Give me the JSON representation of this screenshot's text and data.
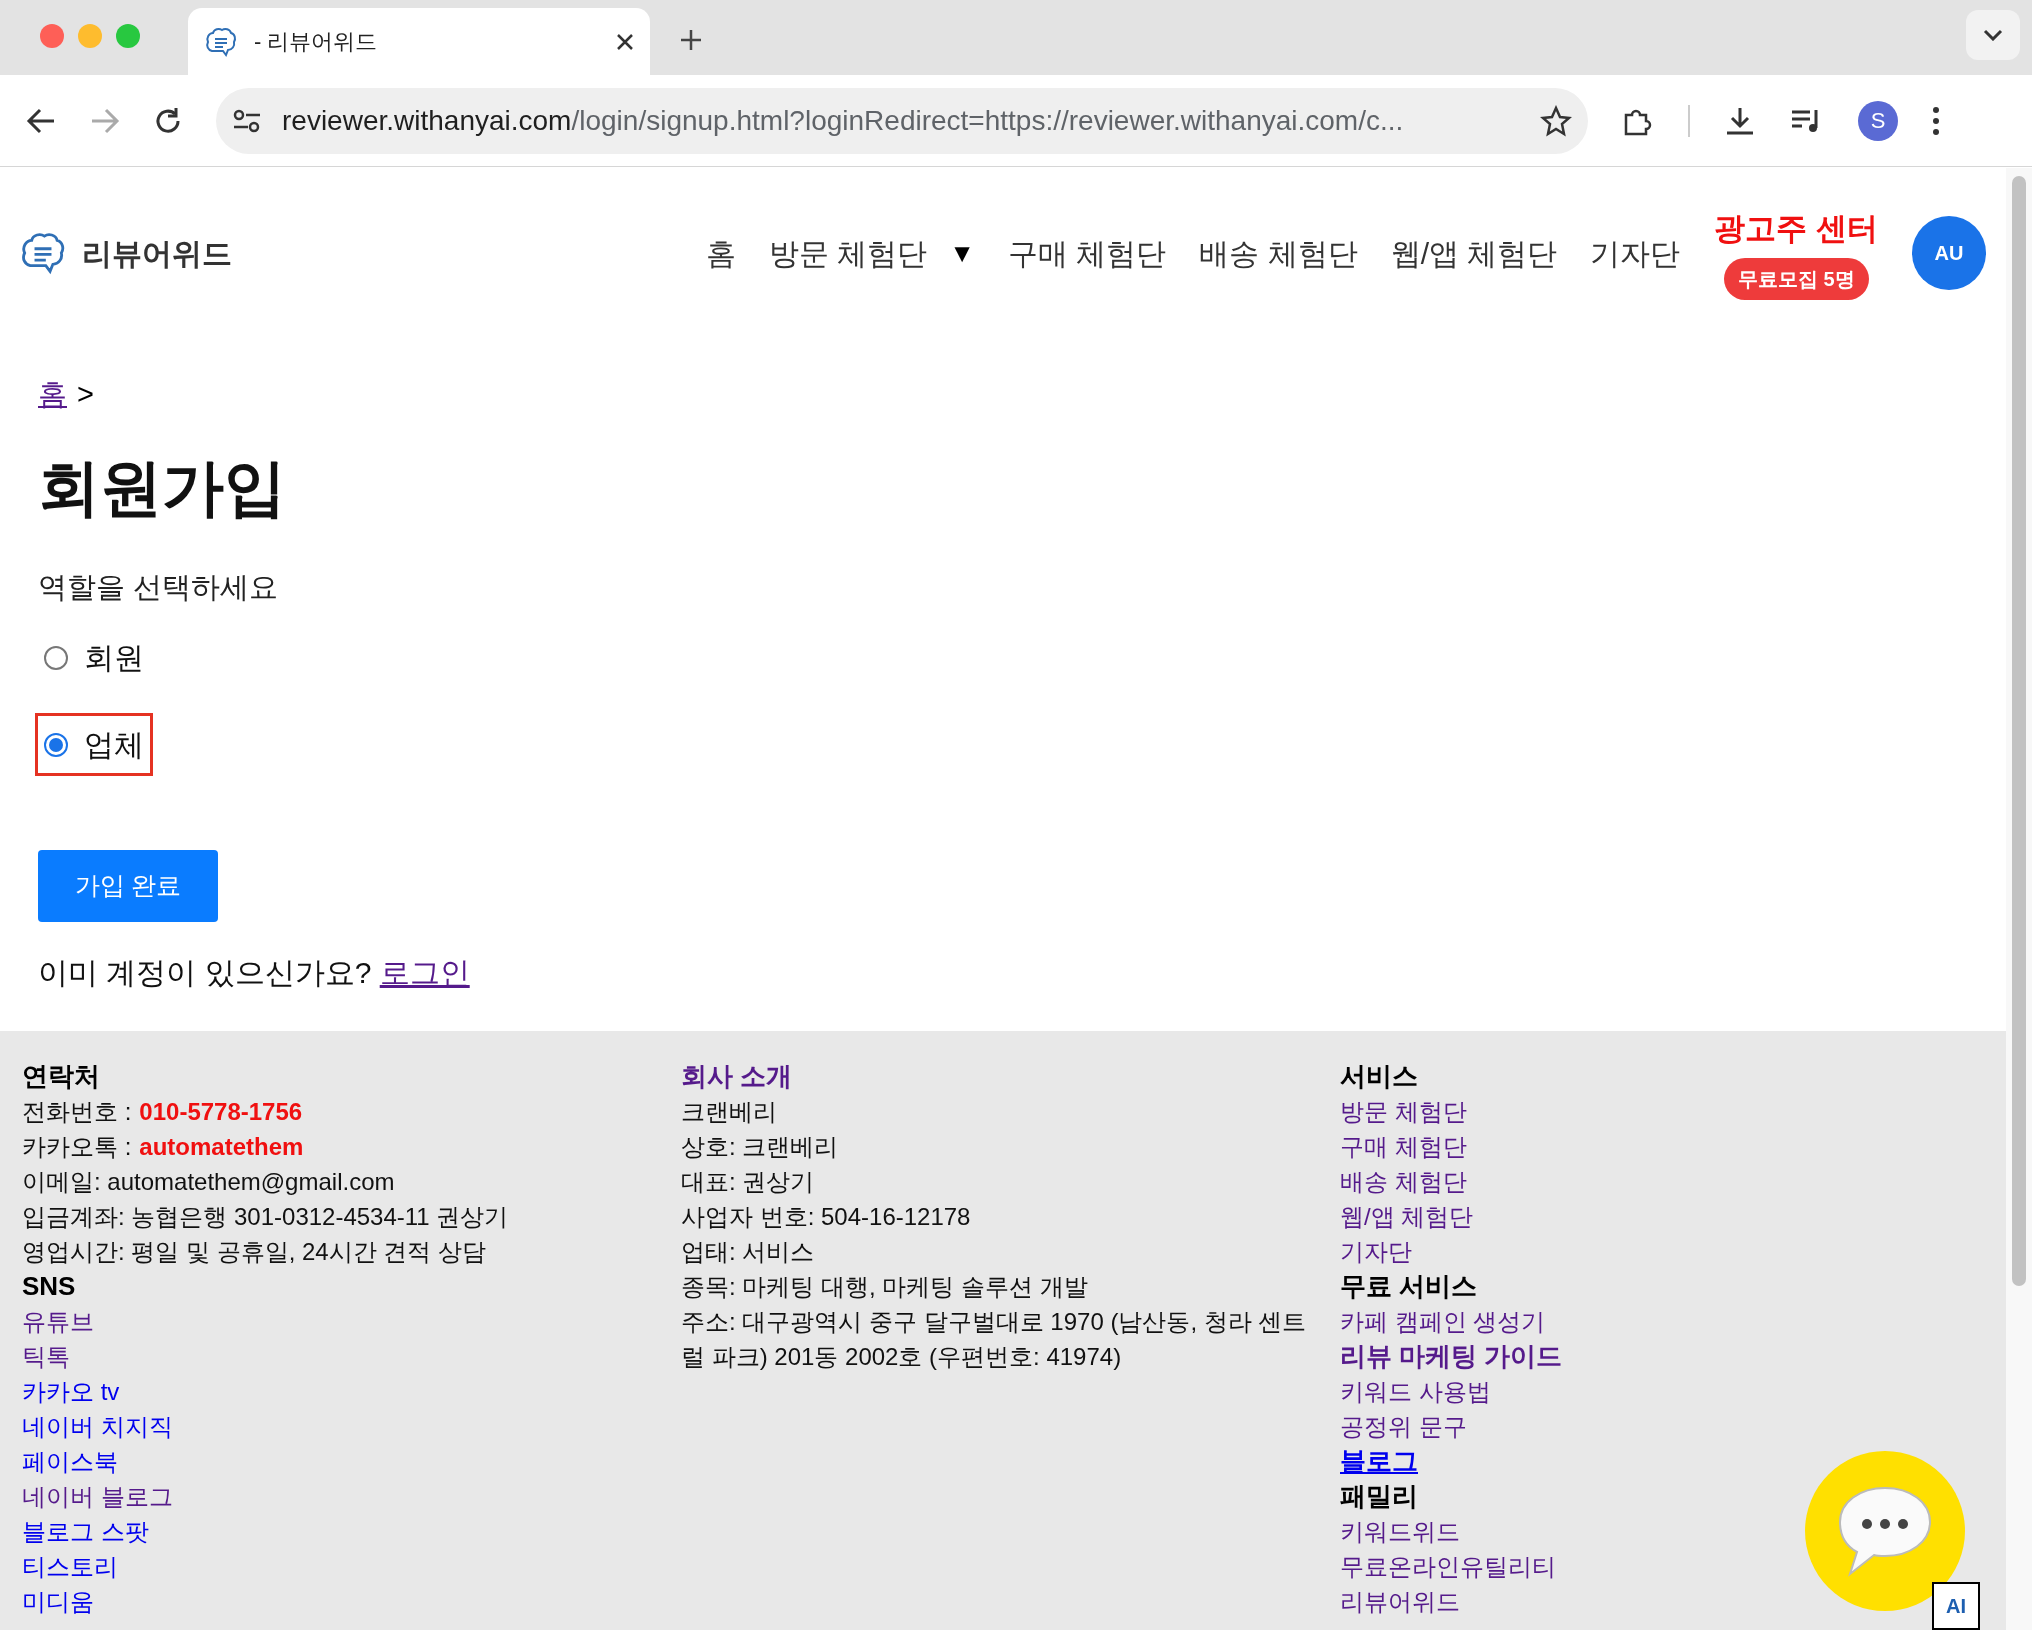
{
  "browser": {
    "tab_title": "- 리뷰어위드",
    "url_host": "reviewer.withanyai.com",
    "url_path": "/login/signup.html?loginRedirect=https://reviewer.withanyai.com/c...",
    "profile_initial": "S"
  },
  "header": {
    "logo_text": "리뷰어위드",
    "nav": [
      {
        "label": "홈"
      },
      {
        "label": "방문 체험단",
        "caret": "▼"
      },
      {
        "label": "구매 체험단"
      },
      {
        "label": "배송 체험단"
      },
      {
        "label": "웹/앱 체험단"
      },
      {
        "label": "기자단"
      }
    ],
    "ad_center": "광고주 센터",
    "ad_badge": "무료모집 5명",
    "avatar": "AU"
  },
  "breadcrumb": {
    "link": "홈",
    "separator": ">"
  },
  "title": "회원가입",
  "role_prompt": "역할을 선택하세요",
  "roles": [
    {
      "label": "회원",
      "selected": false,
      "highlighted": false
    },
    {
      "label": "업체",
      "selected": true,
      "highlighted": true
    }
  ],
  "submit": "가입 완료",
  "login_prompt": {
    "text": "이미 계정이 있으신가요?",
    "link": "로그인"
  },
  "footer": {
    "columns": [
      {
        "items": [
          {
            "kind": "heading",
            "label": "연락처"
          },
          {
            "kind": "pair",
            "label": "전화번호 :",
            "value": "010-5778-1756"
          },
          {
            "kind": "pair",
            "label": "카카오톡 :",
            "value": "automatethem"
          },
          {
            "kind": "text",
            "label": "이메일: automatethem@gmail.com"
          },
          {
            "kind": "text",
            "label": "입금계좌: 농협은행 301-0312-4534-11 권상기"
          },
          {
            "kind": "text",
            "label": "영업시간: 평일 및 공휴일, 24시간 견적 상담"
          },
          {
            "kind": "heading",
            "label": "SNS"
          },
          {
            "kind": "link",
            "label": "유튜브",
            "visited": true
          },
          {
            "kind": "link",
            "label": "틱톡",
            "visited": true
          },
          {
            "kind": "link",
            "label": "카카오 tv",
            "visited": false
          },
          {
            "kind": "link",
            "label": "네이버 치지직",
            "visited": false
          },
          {
            "kind": "link",
            "label": "페이스북",
            "visited": false
          },
          {
            "kind": "link",
            "label": "네이버 블로그",
            "visited": true
          },
          {
            "kind": "link",
            "label": "블로그 스팟",
            "visited": false
          },
          {
            "kind": "link",
            "label": "티스토리",
            "visited": false
          },
          {
            "kind": "link",
            "label": "미디움",
            "visited": false
          }
        ]
      },
      {
        "items": [
          {
            "kind": "heading_link",
            "label": "회사 소개",
            "visited": true
          },
          {
            "kind": "text",
            "label": "크랜베리"
          },
          {
            "kind": "text",
            "label": "상호: 크랜베리"
          },
          {
            "kind": "text",
            "label": "대표: 권상기"
          },
          {
            "kind": "text",
            "label": "사업자 번호: 504-16-12178"
          },
          {
            "kind": "text",
            "label": "업태: 서비스"
          },
          {
            "kind": "text",
            "label": "종목: 마케팅 대행, 마케팅 솔루션 개발"
          },
          {
            "kind": "text",
            "label": "주소: 대구광역시 중구 달구벌대로 1970 (남산동, 청라 센트럴 파크) 201동 2002호 (우편번호: 41974)"
          }
        ]
      },
      {
        "items": [
          {
            "kind": "heading",
            "label": "서비스"
          },
          {
            "kind": "link",
            "label": "방문 체험단",
            "visited": true
          },
          {
            "kind": "link",
            "label": "구매 체험단",
            "visited": true
          },
          {
            "kind": "link",
            "label": "배송 체험단",
            "visited": true
          },
          {
            "kind": "link",
            "label": "웹/앱 체험단",
            "visited": true
          },
          {
            "kind": "link",
            "label": "기자단",
            "visited": true
          },
          {
            "kind": "heading",
            "label": "무료 서비스"
          },
          {
            "kind": "link",
            "label": "카페 캠페인 생성기",
            "visited": true
          },
          {
            "kind": "heading_link",
            "label": "리뷰 마케팅 가이드",
            "visited": true
          },
          {
            "kind": "link",
            "label": "키워드 사용법",
            "visited": true
          },
          {
            "kind": "link",
            "label": "공정위 문구",
            "visited": true
          },
          {
            "kind": "heading_link",
            "label": "블로그",
            "visited": false
          },
          {
            "kind": "heading",
            "label": "패밀리"
          },
          {
            "kind": "link",
            "label": "키워드위드",
            "visited": true
          },
          {
            "kind": "link",
            "label": "무료온라인유틸리티",
            "visited": true
          },
          {
            "kind": "link",
            "label": "리뷰어위드",
            "visited": true
          }
        ]
      }
    ]
  },
  "ai_badge": "AI"
}
